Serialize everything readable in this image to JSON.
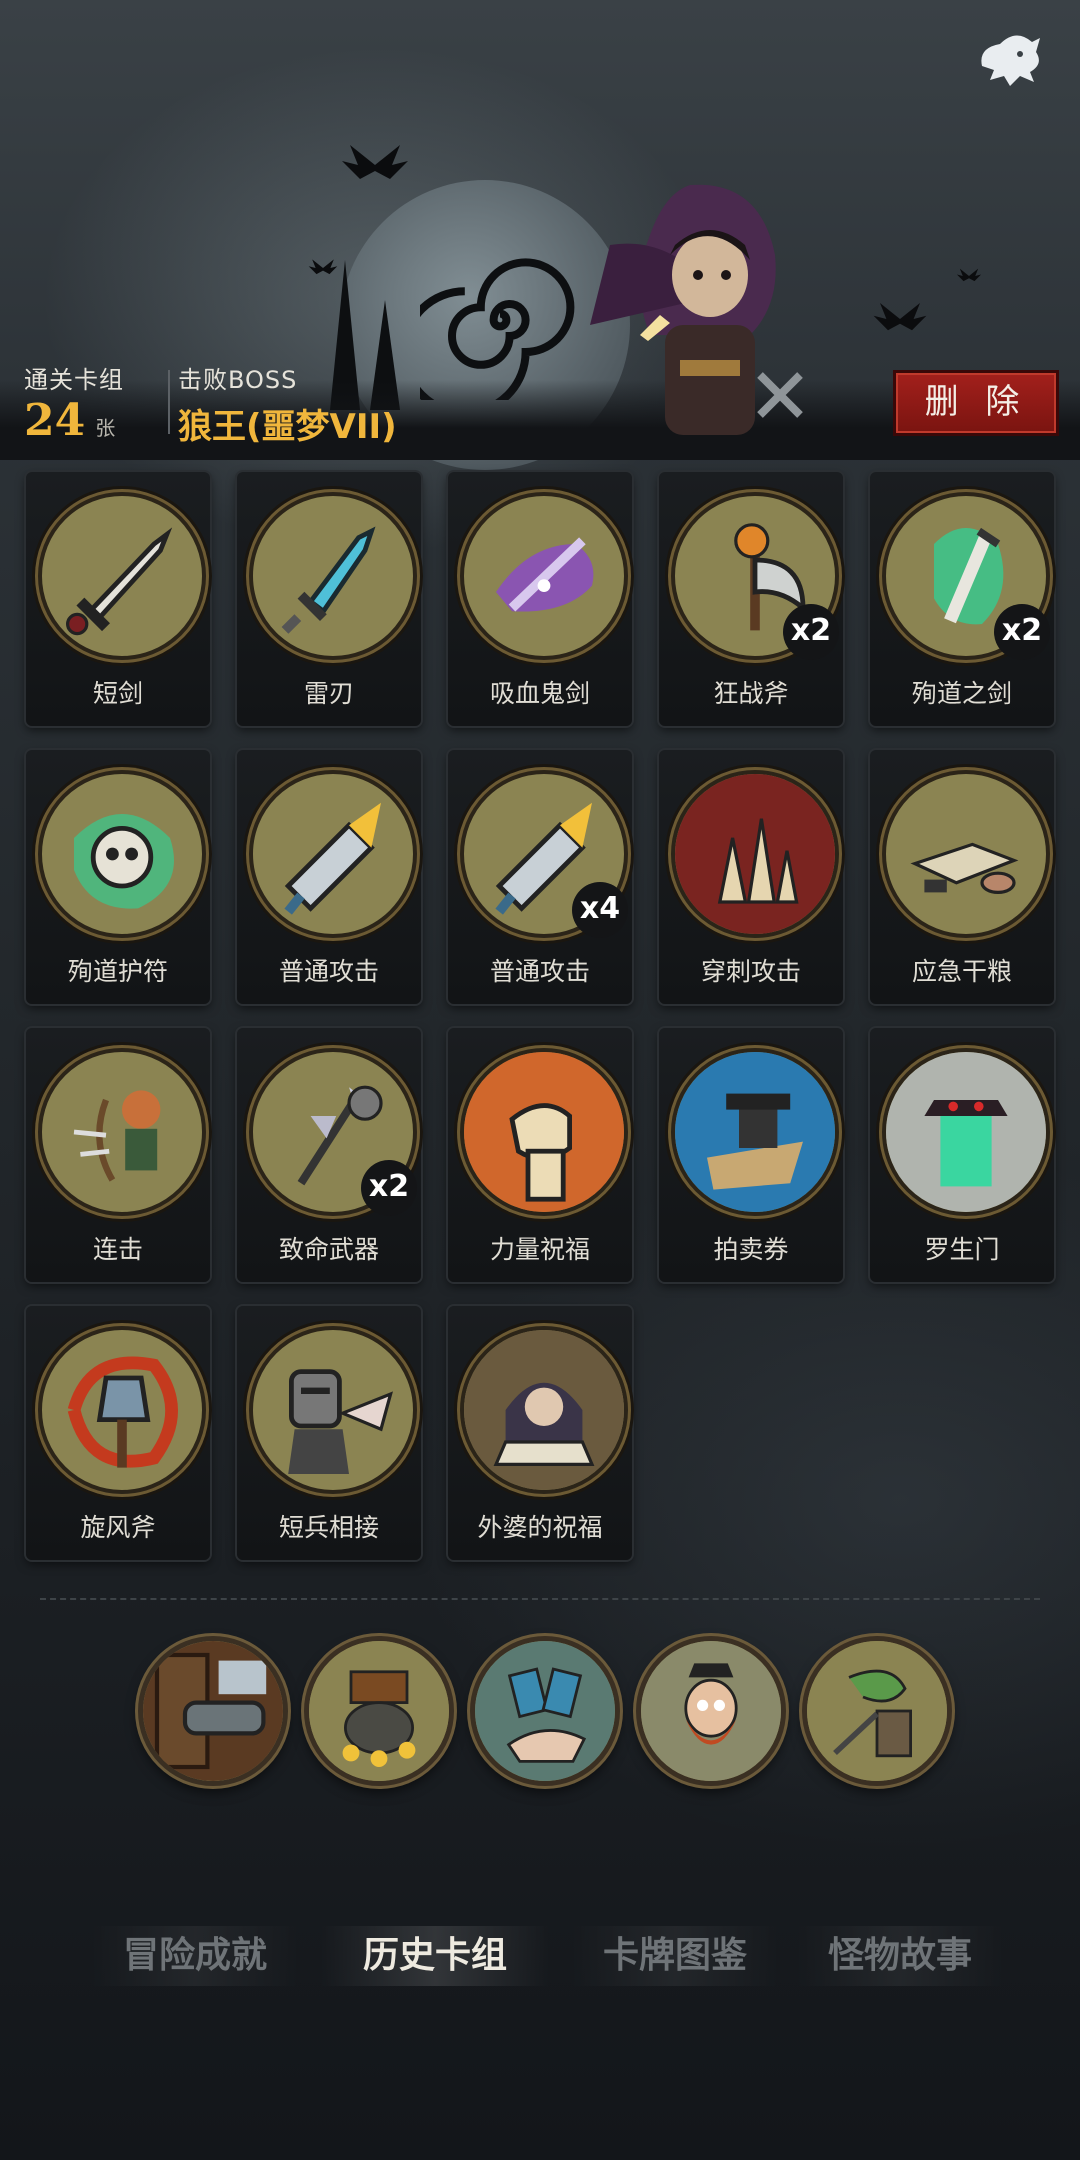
{
  "header": {
    "deck_label": "通关卡组",
    "deck_count": "24",
    "deck_unit": "张",
    "boss_label": "击败BOSS",
    "boss_name": "狼王(噩梦VII)",
    "delete_label": "删 除"
  },
  "cards": [
    {
      "name": "短剑",
      "icon": "short-sword-icon",
      "mult": ""
    },
    {
      "name": "雷刃",
      "icon": "thunder-blade-icon",
      "mult": ""
    },
    {
      "name": "吸血鬼剑",
      "icon": "vampire-sword-icon",
      "mult": ""
    },
    {
      "name": "狂战斧",
      "icon": "berserker-axe-icon",
      "mult": "x2"
    },
    {
      "name": "殉道之剑",
      "icon": "martyr-sword-icon",
      "mult": "x2"
    },
    {
      "name": "殉道护符",
      "icon": "martyr-amulet-icon",
      "mult": ""
    },
    {
      "name": "普通攻击",
      "icon": "normal-attack-icon",
      "mult": ""
    },
    {
      "name": "普通攻击",
      "icon": "normal-attack-icon",
      "mult": "x4"
    },
    {
      "name": "穿刺攻击",
      "icon": "pierce-attack-icon",
      "mult": ""
    },
    {
      "name": "应急干粮",
      "icon": "emergency-rations-icon",
      "mult": ""
    },
    {
      "name": "连击",
      "icon": "combo-archer-icon",
      "mult": ""
    },
    {
      "name": "致命武器",
      "icon": "deadly-weapons-icon",
      "mult": "x2"
    },
    {
      "name": "力量祝福",
      "icon": "strength-fist-icon",
      "mult": ""
    },
    {
      "name": "拍卖券",
      "icon": "auction-hammer-icon",
      "mult": ""
    },
    {
      "name": "罗生门",
      "icon": "rashomon-gate-icon",
      "mult": ""
    },
    {
      "name": "旋风斧",
      "icon": "whirlwind-axe-icon",
      "mult": ""
    },
    {
      "name": "短兵相接",
      "icon": "knight-clash-icon",
      "mult": ""
    },
    {
      "name": "外婆的祝福",
      "icon": "grandma-blessing-icon",
      "mult": ""
    }
  ],
  "relics": [
    {
      "icon": "cannon-relic-icon"
    },
    {
      "icon": "treasure-gold-relic-icon"
    },
    {
      "icon": "magic-cards-hand-relic-icon"
    },
    {
      "icon": "pirate-captain-relic-icon"
    },
    {
      "icon": "serpent-ship-relic-icon"
    }
  ],
  "tabs": [
    {
      "label": "冒险成就",
      "active": false
    },
    {
      "label": "历史卡组",
      "active": true
    },
    {
      "label": "卡牌图鉴",
      "active": false
    },
    {
      "label": "怪物故事",
      "active": false
    }
  ],
  "colors": {
    "accent_gold": "#f0b63c",
    "delete_red": "#a3201c",
    "card_circle": "#8b8452"
  }
}
